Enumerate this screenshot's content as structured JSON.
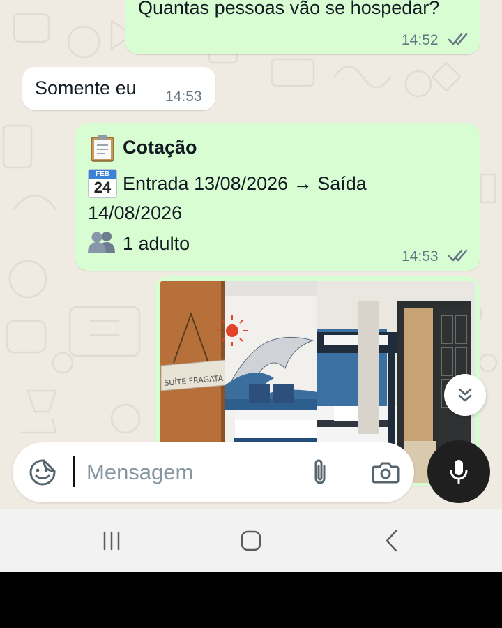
{
  "colors": {
    "chat_background": "#efeae2",
    "outgoing_bubble": "#d9fdd3",
    "incoming_bubble": "#ffffff",
    "meta_text": "#667781",
    "mic_button": "#1f1f1f"
  },
  "messages": [
    {
      "direction": "outgoing",
      "text": "Quantas pessoas vão se hospedar?",
      "time": "14:52",
      "status_icon": "double-check-icon"
    },
    {
      "direction": "incoming",
      "text": "Somente eu",
      "time": "14:53"
    },
    {
      "direction": "outgoing",
      "title": "Cotação",
      "title_icon": "clipboard-emoji",
      "dates_line1": "Entrada 13/08/2026 → Saída",
      "dates_line2": "14/08/2026",
      "calendar_icon": "calendar-emoji",
      "calendar_month": "FEB",
      "calendar_day": "24",
      "guests": "1 adulto",
      "guests_icon": "people-emoji",
      "time": "14:53",
      "status_icon": "double-check-icon"
    },
    {
      "direction": "outgoing",
      "type": "image",
      "sign_text": "SUÍTE FRAGATA"
    }
  ],
  "composer": {
    "placeholder": "Mensagem",
    "value": "",
    "sticker_icon": "sticker-icon",
    "attach_icon": "paperclip-icon",
    "camera_icon": "camera-icon",
    "mic_icon": "microphone-icon"
  },
  "scroll_down_icon": "double-chevron-down-icon",
  "navigation": {
    "recent_icon": "recent-apps-icon",
    "home_icon": "home-icon",
    "back_icon": "back-icon"
  }
}
